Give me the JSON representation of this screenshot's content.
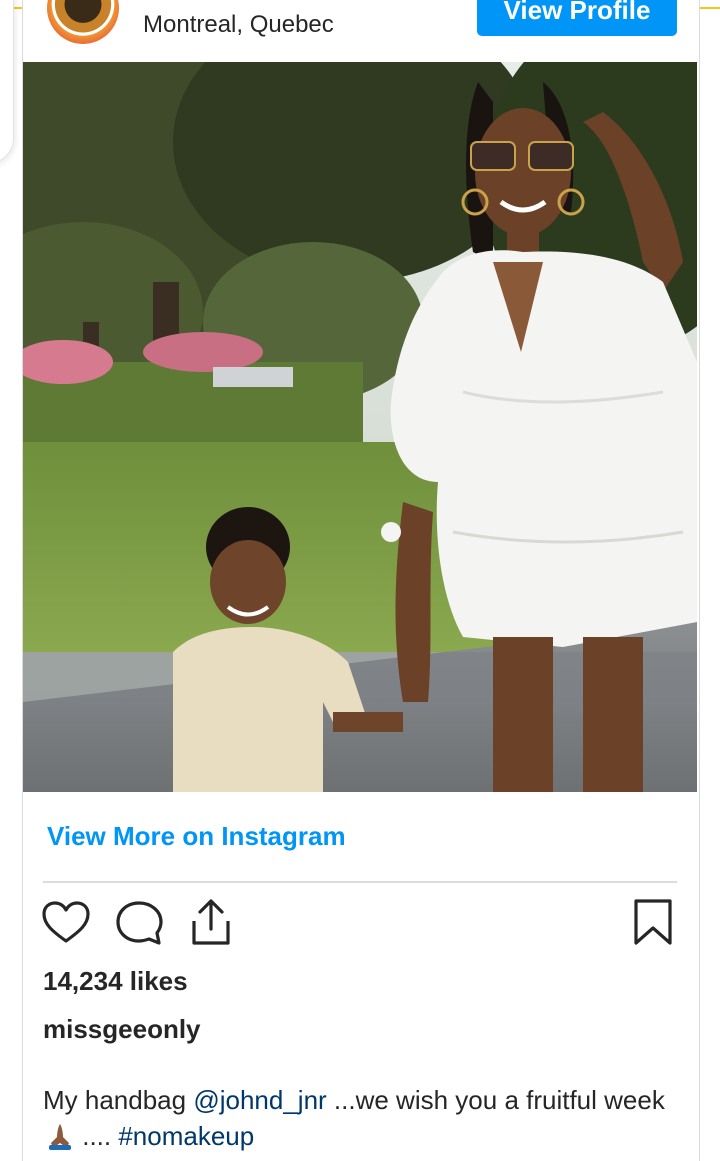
{
  "header": {
    "location": "Montreal, Quebec",
    "view_profile_label": "View Profile"
  },
  "post": {
    "image_alt": "Woman in white dress holding hands with a young boy on a tree-lined street",
    "view_more_label": "View More on Instagram",
    "likes": "14,234 likes",
    "username": "missgeeonly",
    "caption": {
      "prefix": "My handbag ",
      "mention": "@johnd_jnr",
      "middle": " ...we wish you a fruitful week",
      "emoji": "praying-hands-emoji",
      "dots": " .... ",
      "hashtag": "#nomakeup"
    }
  },
  "actions": {
    "like": "heart-icon",
    "comment": "comment-bubble-icon",
    "share": "share-upload-icon",
    "save": "bookmark-icon"
  },
  "colors": {
    "accent": "#0095f6",
    "text": "#262626",
    "link": "#00376b",
    "divider": "#dcdcdc"
  }
}
